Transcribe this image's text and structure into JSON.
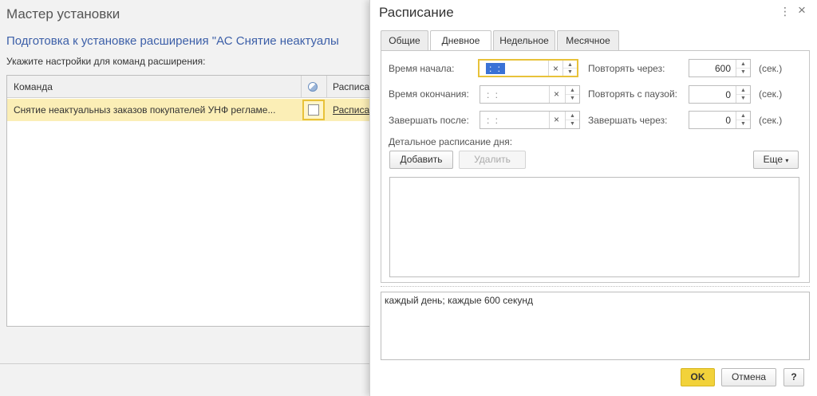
{
  "wizard": {
    "title": "Мастер установки",
    "subtitle": "Подготовка к установке расширения \"АС Снятие неактуалы",
    "hint": "Укажите настройки для команд расширения:",
    "table": {
      "columns": [
        "Команда",
        "Расписа"
      ],
      "rows": [
        {
          "command": "Снятие неактуальныз заказов покупателей УНФ регламе...",
          "checked": false,
          "schedule": "Расписа"
        }
      ]
    }
  },
  "dialog": {
    "title": "Расписание",
    "menu_icon": "⋮",
    "close_icon": "×",
    "tabs": [
      {
        "label": "Общие",
        "active": false
      },
      {
        "label": "Дневное",
        "active": true
      },
      {
        "label": "Недельное",
        "active": false
      },
      {
        "label": "Месячное",
        "active": false
      }
    ],
    "daily": {
      "start_label": "Время начала:",
      "start_value": ": :",
      "end_label": "Время окончания:",
      "end_value": ": :",
      "finish_after_label": "Завершать после:",
      "finish_after_value": ": :",
      "repeat_every_label": "Повторять через:",
      "repeat_every_value": "600",
      "repeat_pause_label": "Повторять с паузой:",
      "repeat_pause_value": "0",
      "finish_in_label": "Завершать через:",
      "finish_in_value": "0",
      "unit": "(сек.)",
      "detail_label": "Детальное расписание дня:",
      "add_button": "Добавить",
      "delete_button": "Удалить",
      "more_button": "Еще",
      "clear_glyph": "×"
    },
    "summary": "каждый день; каждые 600 секунд",
    "ok_button": "OK",
    "cancel_button": "Отмена",
    "help_button": "?"
  },
  "colors": {
    "accent_yellow": "#f2d23a",
    "row_highlight": "#fbeeb6",
    "link_blue": "#3c5fa8",
    "selection_blue": "#3a72d6"
  }
}
